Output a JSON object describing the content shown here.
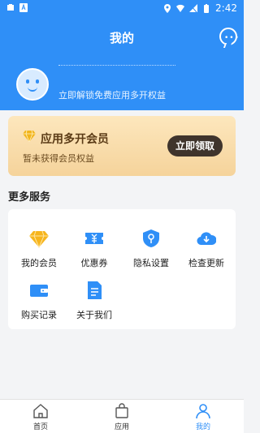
{
  "status": {
    "time": "2:42"
  },
  "header": {
    "title": "我的",
    "subtitle": "立即解锁免费应用多开权益"
  },
  "vip_card": {
    "title": "应用多开会员",
    "description": "暂未获得会员权益",
    "claim_label": "立即领取"
  },
  "more_services": {
    "title": "更多服务",
    "items": [
      {
        "label": "我的会员",
        "icon": "diamond-icon"
      },
      {
        "label": "优惠券",
        "icon": "coupon-icon"
      },
      {
        "label": "隐私设置",
        "icon": "privacy-shield-icon"
      },
      {
        "label": "检查更新",
        "icon": "cloud-download-icon"
      },
      {
        "label": "购买记录",
        "icon": "wallet-icon"
      },
      {
        "label": "关于我们",
        "icon": "document-icon"
      }
    ]
  },
  "bottom_nav": {
    "items": [
      {
        "label": "首页",
        "icon": "home-icon"
      },
      {
        "label": "应用",
        "icon": "bag-icon"
      },
      {
        "label": "我的",
        "icon": "user-icon"
      }
    ],
    "active": "我的"
  },
  "colors": {
    "primary": "#2f8ff7",
    "vip_gold": "#f5d39b",
    "vip_text": "#5b3b16",
    "claim_button": "#3f342c"
  }
}
